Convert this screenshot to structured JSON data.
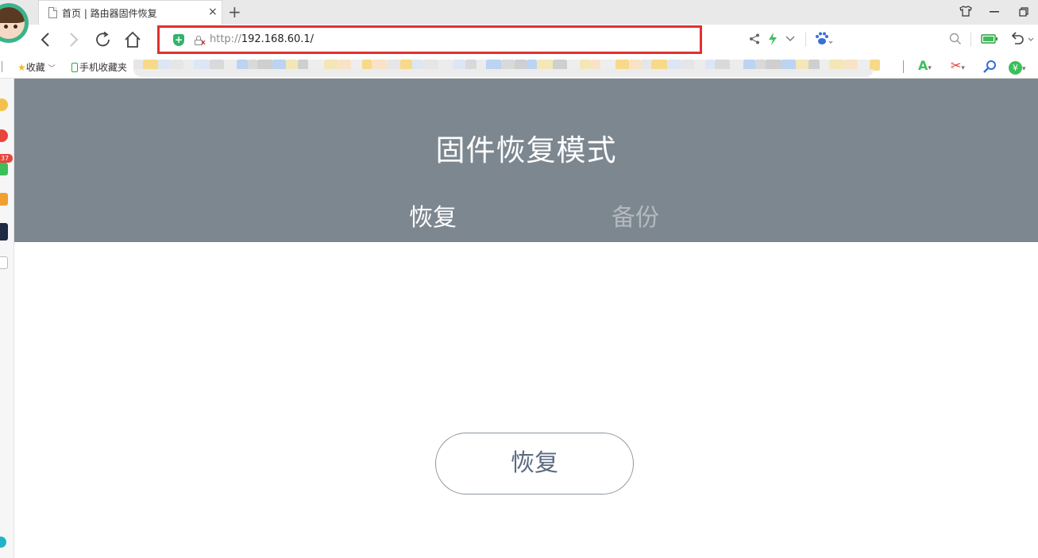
{
  "browser": {
    "tab": {
      "title": "首页 | 路由器固件恢复",
      "close_glyph": "×"
    },
    "new_tab_glyph": "+",
    "window_controls": [
      "minimize",
      "restore"
    ],
    "address": {
      "protocol": "http://",
      "host": "192.168.60.1/"
    },
    "bookmarks": {
      "favorites_label": "收藏",
      "mobile_label": "手机收藏夹"
    },
    "sidebar_badge": "37"
  },
  "page": {
    "title": "固件恢复模式",
    "tabs": [
      {
        "label": "恢复",
        "active": true
      },
      {
        "label": "备份",
        "active": false
      }
    ],
    "restore_button": "恢复"
  },
  "colors": {
    "hero_bg": "#7d8790",
    "address_highlight": "#e0312f",
    "button_border": "#8c96a2",
    "button_text": "#5b6b80",
    "inactive_tab": "#b3b9bf"
  },
  "icons": [
    "page-icon",
    "close-icon",
    "plus-icon",
    "shirt-icon",
    "minimize-icon",
    "restore-window-icon",
    "back-icon",
    "forward-icon",
    "reload-icon",
    "home-icon",
    "shield-icon",
    "lock-icon",
    "share-icon",
    "lightning-icon",
    "chevron-down-icon",
    "paw-icon",
    "search-icon",
    "battery-icon",
    "undo-icon",
    "star-icon",
    "phone-icon",
    "translate-icon",
    "scissors-icon",
    "magnifier-icon",
    "yuan-icon"
  ]
}
